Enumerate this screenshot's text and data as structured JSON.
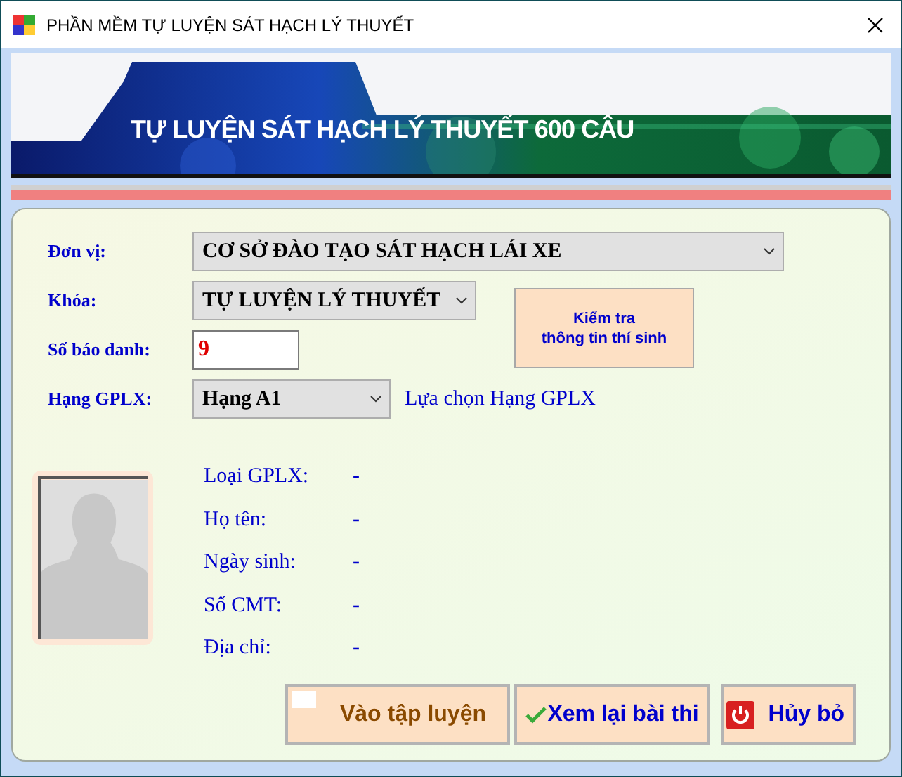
{
  "window": {
    "title": "PHẦN MỀM TỰ LUYỆN SÁT HẠCH LÝ THUYẾT"
  },
  "banner": {
    "title": "TỰ LUYỆN SÁT HẠCH LÝ THUYẾT 600 CÂU"
  },
  "form": [
    {
      "label": "Đơn vị:",
      "kind": "select",
      "value": "CƠ SỞ ĐÀO TẠO SÁT HẠCH LÁI XE"
    },
    {
      "label": "Khóa:",
      "kind": "select",
      "value": "TỰ LUYỆN LÝ THUYẾT"
    },
    {
      "label": "Số báo danh:",
      "kind": "input",
      "value": "9"
    },
    {
      "label": "Hạng GPLX:",
      "kind": "select",
      "value": "Hạng A1",
      "hint": "Lựa chọn Hạng GPLX"
    }
  ],
  "check_button": {
    "lines": [
      "Kiểm tra",
      "thông tin thí sinh"
    ]
  },
  "info": [
    {
      "label": "Loại GPLX:",
      "value": "-"
    },
    {
      "label": "Họ tên:",
      "value": "-"
    },
    {
      "label": "Ngày sinh:",
      "value": "-"
    },
    {
      "label": "Số CMT:",
      "value": "-"
    },
    {
      "label": "Địa chỉ:",
      "value": "-"
    }
  ],
  "buttons": [
    {
      "label": "Vào tập luyện",
      "kind": "blank"
    },
    {
      "label": "Xem lại bài thi",
      "kind": "check"
    },
    {
      "label": "Hủy bỏ",
      "kind": "power"
    }
  ]
}
